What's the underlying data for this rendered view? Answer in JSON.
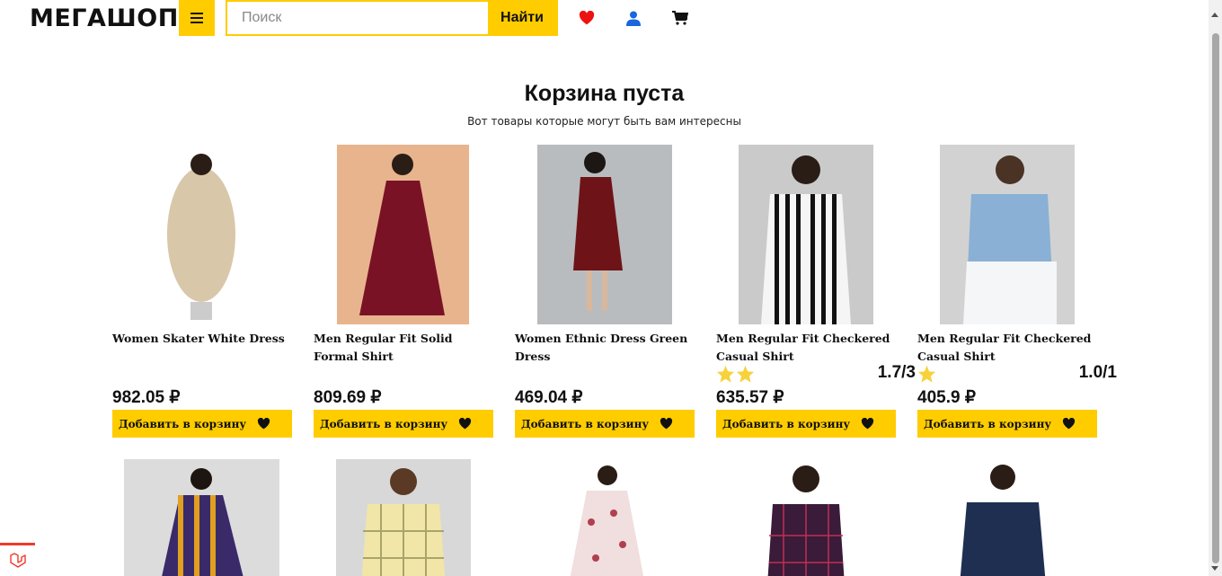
{
  "header": {
    "logo": "МЕГАШОП",
    "search_placeholder": "Поиск",
    "search_value": "",
    "search_button": "Найти",
    "icons": [
      "menu-icon",
      "heart-icon",
      "user-icon",
      "cart-icon"
    ]
  },
  "colors": {
    "accent": "#ffcc00",
    "heart": "#ee1111",
    "user": "#1a66dd",
    "star": "#f7d23a"
  },
  "cart": {
    "title": "Корзина пуста",
    "subtitle": "Вот товары которые могут быть вам интересны"
  },
  "products": [
    {
      "name": "Women Skater White Dress",
      "price": "982.05 ₽",
      "button": "Добавить в корзину",
      "stars": 0,
      "rating": ""
    },
    {
      "name": "Men Regular Fit Solid Formal Shirt",
      "price": "809.69 ₽",
      "button": "Добавить в корзину",
      "stars": 0,
      "rating": ""
    },
    {
      "name": "Women Ethnic Dress Green Dress",
      "price": "469.04 ₽",
      "button": "Добавить в корзину",
      "stars": 0,
      "rating": ""
    },
    {
      "name": "Men Regular Fit Checkered Casual Shirt",
      "price": "635.57 ₽",
      "button": "Добавить в корзину",
      "stars": 2,
      "rating": "1.7/3"
    },
    {
      "name": "Men Regular Fit Checkered Casual Shirt",
      "price": "405.9 ₽",
      "button": "Добавить в корзину",
      "stars": 1,
      "rating": "1.0/1"
    }
  ],
  "second_row": [
    {
      "alt": "striped dress"
    },
    {
      "alt": "checkered shirt"
    },
    {
      "alt": "floral dress"
    },
    {
      "alt": "checkered shirt"
    },
    {
      "alt": "navy shirt"
    }
  ]
}
